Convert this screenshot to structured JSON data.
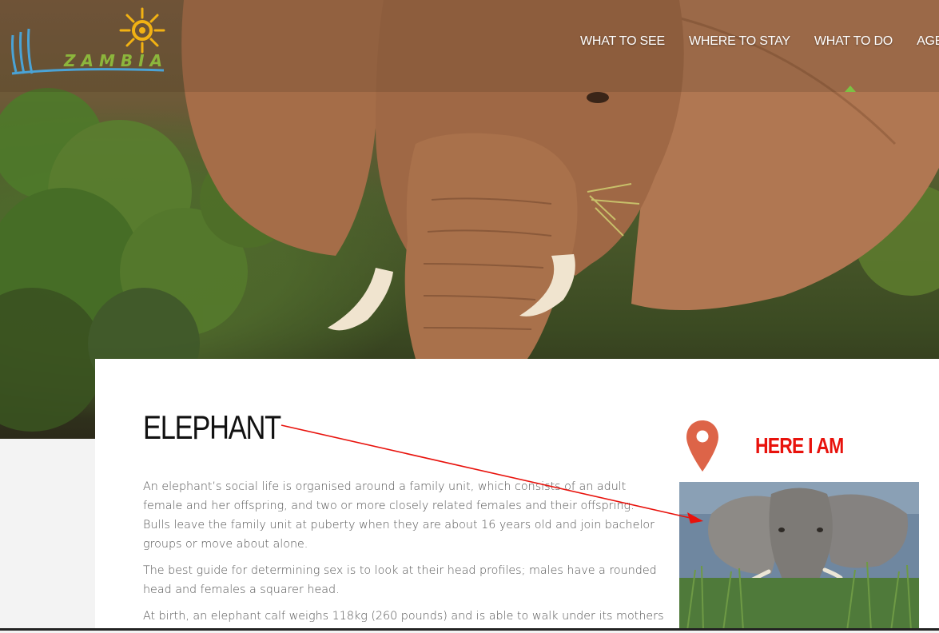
{
  "brand": {
    "logo_text": "ZAMBIA"
  },
  "nav": {
    "items": [
      {
        "label": "WHAT TO SEE"
      },
      {
        "label": "WHERE TO STAY"
      },
      {
        "label": "WHAT TO DO"
      },
      {
        "label": "AGEN"
      }
    ],
    "active_index": 2
  },
  "article": {
    "title": "ELEPHANT",
    "paragraphs": [
      "An elephant’s social life is organised around a family unit, which consists of an adult female and her offspring, and two or more closely related females and their offspring. Bulls leave the family unit at puberty when they are about 16 years old and join bachelor groups or move about alone.",
      "The best guide for determining sex is to look at their head profiles; males have a rounded head and females a squarer head.",
      "At birth, an elephant calf weighs 118kg (260 pounds) and is able to walk under its mothers"
    ]
  },
  "location": {
    "annotation": "HERE I AM"
  },
  "colors": {
    "nav_text": "#ffffff",
    "active_indicator": "#7cc143",
    "pin": "#dd6448",
    "annotation": "#e8120c",
    "logo_green": "#8cb63c",
    "logo_sun": "#f2b213"
  },
  "icons": {
    "pin": "map-pin-icon",
    "sun": "sun-icon"
  }
}
